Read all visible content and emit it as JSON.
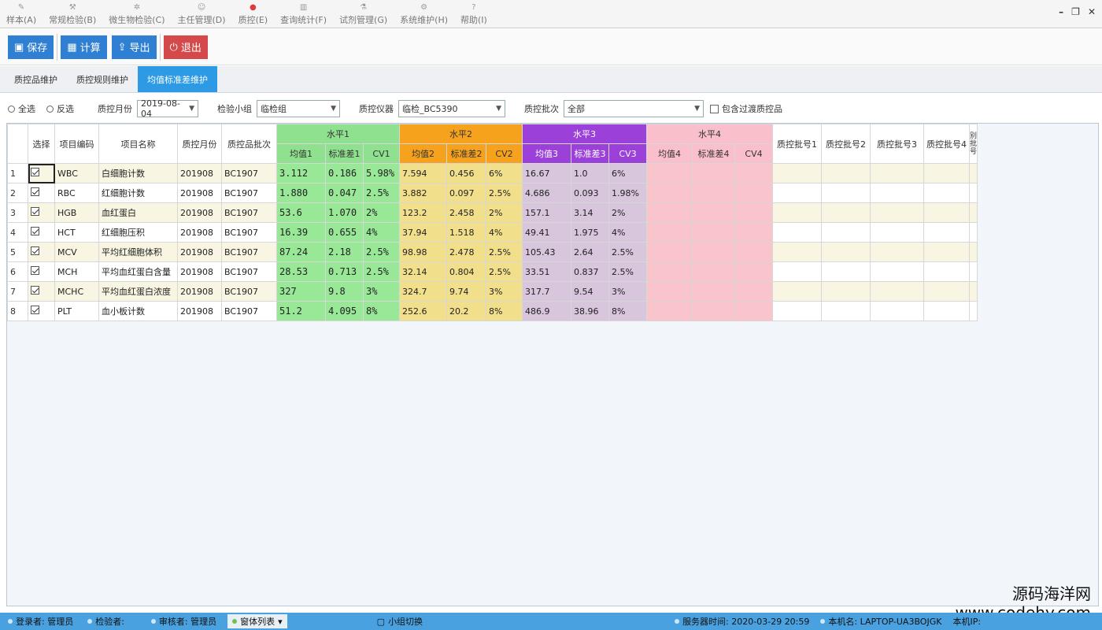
{
  "menu": {
    "items": [
      {
        "label": "样本(A)",
        "icon": "pencil-icon"
      },
      {
        "label": "常规检验(B)",
        "icon": "tool-icon"
      },
      {
        "label": "微生物检验(C)",
        "icon": "bug-icon"
      },
      {
        "label": "主任管理(D)",
        "icon": "user-icon"
      },
      {
        "label": "质控(E)",
        "icon": "dot-icon"
      },
      {
        "label": "查询统计(F)",
        "icon": "chart-icon"
      },
      {
        "label": "试剂管理(G)",
        "icon": "flask-icon"
      },
      {
        "label": "系统维护(H)",
        "icon": "gear-icon"
      },
      {
        "label": "帮助(I)",
        "icon": "help-icon"
      }
    ]
  },
  "toolbar": {
    "save_label": "保存",
    "calc_label": "计算",
    "export_label": "导出",
    "exit_label": "退出"
  },
  "tabs": [
    {
      "label": "质控品维护"
    },
    {
      "label": "质控规则维护"
    },
    {
      "label": "均值标准差维护"
    }
  ],
  "filters": {
    "select_all": "全选",
    "invert": "反选",
    "month_label": "质控月份",
    "month_value": "2019-08-04",
    "group_label": "检验小组",
    "group_value": "临检组",
    "instrument_label": "质控仪器",
    "instrument_value": "临检_BC5390",
    "batch_label": "质控批次",
    "batch_value": "全部",
    "include_transition": "包含过渡质控品"
  },
  "grid": {
    "headers": {
      "select": "选择",
      "code": "项目编码",
      "name": "项目名称",
      "month": "质控月份",
      "batch": "质控品批次",
      "level1": "水平1",
      "level2": "水平2",
      "level3": "水平3",
      "level4": "水平4",
      "mean1": "均值1",
      "sd1": "标准差1",
      "cv1": "CV1",
      "mean2": "均值2",
      "sd2": "标准差2",
      "cv2": "CV2",
      "mean3": "均值3",
      "sd3": "标准差3",
      "cv3": "CV3",
      "mean4": "均值4",
      "sd4": "标准差4",
      "cv4": "CV4",
      "lot1": "质控批号1",
      "lot2": "质控批号2",
      "lot3": "质控批号3",
      "lot4": "质控批号4",
      "extra": "别批号"
    },
    "rows": [
      {
        "n": "1",
        "code": "WBC",
        "name": "白细胞计数",
        "month": "201908",
        "batch": "BC1907",
        "m1": "3.112",
        "s1": "0.186",
        "c1": "5.98%",
        "m2": "7.594",
        "s2": "0.456",
        "c2": "6%",
        "m3": "16.67",
        "s3": "1.0",
        "c3": "6%"
      },
      {
        "n": "2",
        "code": "RBC",
        "name": "红细胞计数",
        "month": "201908",
        "batch": "BC1907",
        "m1": "1.880",
        "s1": "0.047",
        "c1": "2.5%",
        "m2": "3.882",
        "s2": "0.097",
        "c2": "2.5%",
        "m3": "4.686",
        "s3": "0.093",
        "c3": "1.98%"
      },
      {
        "n": "3",
        "code": "HGB",
        "name": "血红蛋白",
        "month": "201908",
        "batch": "BC1907",
        "m1": "53.6",
        "s1": "1.070",
        "c1": "2%",
        "m2": "123.2",
        "s2": "2.458",
        "c2": "2%",
        "m3": "157.1",
        "s3": "3.14",
        "c3": "2%"
      },
      {
        "n": "4",
        "code": "HCT",
        "name": "红细胞压积",
        "month": "201908",
        "batch": "BC1907",
        "m1": "16.39",
        "s1": "0.655",
        "c1": "4%",
        "m2": "37.94",
        "s2": "1.518",
        "c2": "4%",
        "m3": "49.41",
        "s3": "1.975",
        "c3": "4%"
      },
      {
        "n": "5",
        "code": "MCV",
        "name": "平均红细胞体积",
        "month": "201908",
        "batch": "BC1907",
        "m1": "87.24",
        "s1": "2.18",
        "c1": "2.5%",
        "m2": "98.98",
        "s2": "2.478",
        "c2": "2.5%",
        "m3": "105.43",
        "s3": "2.64",
        "c3": "2.5%"
      },
      {
        "n": "6",
        "code": "MCH",
        "name": "平均血红蛋白含量",
        "month": "201908",
        "batch": "BC1907",
        "m1": "28.53",
        "s1": "0.713",
        "c1": "2.5%",
        "m2": "32.14",
        "s2": "0.804",
        "c2": "2.5%",
        "m3": "33.51",
        "s3": "0.837",
        "c3": "2.5%"
      },
      {
        "n": "7",
        "code": "MCHC",
        "name": "平均血红蛋白浓度",
        "month": "201908",
        "batch": "BC1907",
        "m1": "327",
        "s1": "9.8",
        "c1": "3%",
        "m2": "324.7",
        "s2": "9.74",
        "c2": "3%",
        "m3": "317.7",
        "s3": "9.54",
        "c3": "3%"
      },
      {
        "n": "8",
        "code": "PLT",
        "name": "血小板计数",
        "month": "201908",
        "batch": "BC1907",
        "m1": "51.2",
        "s1": "4.095",
        "c1": "8%",
        "m2": "252.6",
        "s2": "20.2",
        "c2": "8%",
        "m3": "486.9",
        "s3": "38.96",
        "c3": "8%"
      }
    ]
  },
  "status": {
    "login": "登录者: 管理员",
    "tester": "检验者:",
    "reviewer": "审核者: 管理员",
    "window_list": "窗体列表",
    "group_switch": "小组切换",
    "server_time": "服务器时间: 2020-03-29 20:59",
    "host": "本机名: LAPTOP-UA3BOJGK",
    "ip": "本机IP:"
  },
  "watermark": {
    "line1": "源码海洋网",
    "line2": "www.codehy.com"
  },
  "colors": {
    "level1": "#8fe18f",
    "level2": "#f6a21c",
    "level3": "#9b40d8",
    "level4": "#f9bfca",
    "accent": "#2d9ae6"
  }
}
